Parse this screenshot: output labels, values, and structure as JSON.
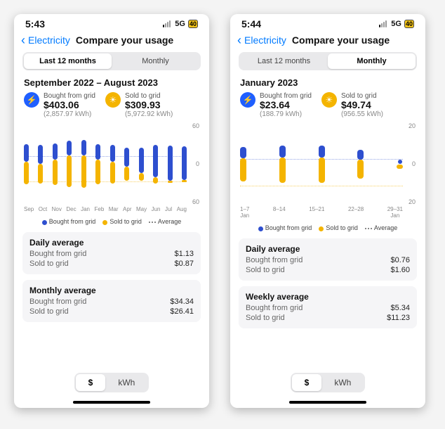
{
  "phones": [
    {
      "status": {
        "time": "5:43",
        "carrier": "5G",
        "battery": "40"
      },
      "nav": {
        "back": "Electricity",
        "title": "Compare your usage"
      },
      "tabs": {
        "a": "Last 12 months",
        "b": "Monthly",
        "selected": "a"
      },
      "range": "September 2022 – August 2023",
      "bought": {
        "label": "Bought from grid",
        "amount": "$403.06",
        "sub": "(2,857.97 kWh)"
      },
      "sold": {
        "label": "Sold to grid",
        "amount": "$309.93",
        "sub": "(5,972.92 kWh)"
      },
      "chart_axis": {
        "top": "60",
        "mid": "0",
        "bot": "60"
      },
      "xlabels": [
        "Sep",
        "Oct",
        "Nov",
        "Dec",
        "Jan",
        "Feb",
        "Mar",
        "Apr",
        "May",
        "Jun",
        "Jul",
        "Aug"
      ],
      "legend": {
        "a": "Bought from grid",
        "b": "Sold to grid",
        "c": "Average"
      },
      "summary1": {
        "title": "Daily average",
        "rows": [
          {
            "k": "Bought from grid",
            "v": "$1.13"
          },
          {
            "k": "Sold to grid",
            "v": "$0.87"
          }
        ]
      },
      "summary2": {
        "title": "Monthly average",
        "rows": [
          {
            "k": "Bought from grid",
            "v": "$34.34"
          },
          {
            "k": "Sold to grid",
            "v": "$26.41"
          }
        ]
      },
      "unit": {
        "a": "$",
        "b": "kWh",
        "selected": "a"
      }
    },
    {
      "status": {
        "time": "5:44",
        "carrier": "5G",
        "battery": "40"
      },
      "nav": {
        "back": "Electricity",
        "title": "Compare your usage"
      },
      "tabs": {
        "a": "Last 12 months",
        "b": "Monthly",
        "selected": "b"
      },
      "range": "January 2023",
      "bought": {
        "label": "Bought from grid",
        "amount": "$23.64",
        "sub": "(188.79 kWh)"
      },
      "sold": {
        "label": "Sold to grid",
        "amount": "$49.74",
        "sub": "(956.55 kWh)"
      },
      "chart_axis": {
        "top": "20",
        "mid": "0",
        "bot": "20"
      },
      "xlabels": [
        "1–7\nJan",
        "8–14",
        "15–21",
        "22–28",
        "29–31\nJan"
      ],
      "legend": {
        "a": "Bought from grid",
        "b": "Sold to grid",
        "c": "Average"
      },
      "summary1": {
        "title": "Daily average",
        "rows": [
          {
            "k": "Bought from grid",
            "v": "$0.76"
          },
          {
            "k": "Sold to grid",
            "v": "$1.60"
          }
        ]
      },
      "summary2": {
        "title": "Weekly average",
        "rows": [
          {
            "k": "Bought from grid",
            "v": "$5.34"
          },
          {
            "k": "Sold to grid",
            "v": "$11.23"
          }
        ]
      },
      "unit": {
        "a": "$",
        "b": "kWh",
        "selected": "a"
      }
    }
  ],
  "chart_data": [
    {
      "type": "bar",
      "title": "Compare your usage — Last 12 months ($)",
      "categories": [
        "Sep",
        "Oct",
        "Nov",
        "Dec",
        "Jan",
        "Feb",
        "Mar",
        "Apr",
        "May",
        "Jun",
        "Jul",
        "Aug"
      ],
      "ylim": [
        -60,
        60
      ],
      "series": [
        {
          "name": "Bought from grid",
          "values": [
            28,
            30,
            25,
            22,
            24,
            24,
            26,
            30,
            40,
            50,
            55,
            52
          ]
        },
        {
          "name": "Sold to grid (negative)",
          "values": [
            -35,
            -30,
            -40,
            -50,
            -50,
            -38,
            -34,
            -22,
            -12,
            -10,
            -3,
            -2
          ]
        }
      ],
      "reference_lines": [
        {
          "name": "Average bought",
          "value": 34
        },
        {
          "name": "Average sold",
          "value": -26
        }
      ]
    },
    {
      "type": "bar",
      "title": "Compare your usage — January 2023 weekly ($)",
      "categories": [
        "1–7",
        "8–14",
        "15–21",
        "22–28",
        "29–31"
      ],
      "ylim": [
        -20,
        20
      ],
      "series": [
        {
          "name": "Bought from grid",
          "values": [
            6,
            6,
            6,
            5,
            1
          ]
        },
        {
          "name": "Sold to grid (negative)",
          "values": [
            -12,
            -13,
            -13,
            -10,
            -2
          ]
        }
      ],
      "reference_lines": [
        {
          "name": "Average bought",
          "value": 5
        },
        {
          "name": "Average sold",
          "value": -11
        }
      ]
    }
  ]
}
